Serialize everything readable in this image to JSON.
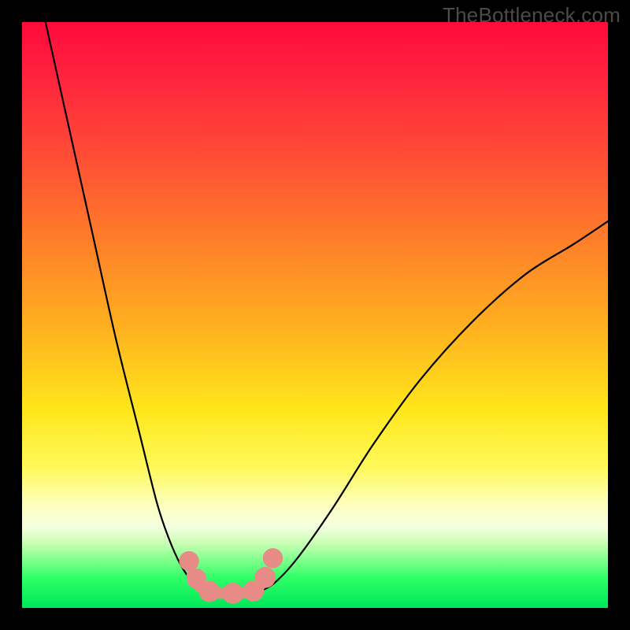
{
  "watermark": "TheBottleneck.com",
  "chart_data": {
    "type": "line",
    "title": "",
    "xlabel": "",
    "ylabel": "",
    "xlim": [
      0,
      100
    ],
    "ylim": [
      0,
      100
    ],
    "background_gradient": {
      "top": "#ff0a3a",
      "mid1": "#ff7a2a",
      "mid2": "#ffe61a",
      "mid3": "#fdffb8",
      "bottom": "#00e65a"
    },
    "series": [
      {
        "name": "left-curve",
        "stroke": "#000000",
        "x": [
          4,
          8,
          12,
          16,
          20,
          23,
          25,
          27,
          29,
          30.5,
          32
        ],
        "y": [
          100,
          82,
          64,
          46,
          30,
          18,
          12,
          7.5,
          4.5,
          3.2,
          2.6
        ]
      },
      {
        "name": "right-curve",
        "stroke": "#000000",
        "x": [
          40,
          43,
          47,
          53,
          60,
          68,
          77,
          86,
          94,
          100
        ],
        "y": [
          2.6,
          4.2,
          8.5,
          17,
          28,
          39,
          49,
          57,
          62,
          66
        ]
      },
      {
        "name": "trough-band",
        "stroke": "#e78b86",
        "x": [
          29,
          30.5,
          32,
          34,
          36,
          38,
          40,
          41.5
        ],
        "y": [
          5.5,
          3.5,
          2.7,
          2.5,
          2.5,
          2.6,
          3.2,
          5.0
        ]
      }
    ],
    "markers": [
      {
        "name": "left-marker-a",
        "x": 28.5,
        "y": 8.0,
        "r": 1.7,
        "fill": "#e78b86"
      },
      {
        "name": "left-marker-b",
        "x": 29.8,
        "y": 5.0,
        "r": 1.7,
        "fill": "#e78b86"
      },
      {
        "name": "trough-marker-a",
        "x": 32.0,
        "y": 2.8,
        "r": 1.8,
        "fill": "#e78b86"
      },
      {
        "name": "trough-marker-b",
        "x": 36.0,
        "y": 2.5,
        "r": 1.8,
        "fill": "#e78b86"
      },
      {
        "name": "trough-marker-c",
        "x": 39.5,
        "y": 2.9,
        "r": 1.8,
        "fill": "#e78b86"
      },
      {
        "name": "right-marker-a",
        "x": 41.5,
        "y": 5.2,
        "r": 1.8,
        "fill": "#e78b86"
      },
      {
        "name": "right-marker-b",
        "x": 42.8,
        "y": 8.5,
        "r": 1.7,
        "fill": "#e78b86"
      }
    ]
  }
}
